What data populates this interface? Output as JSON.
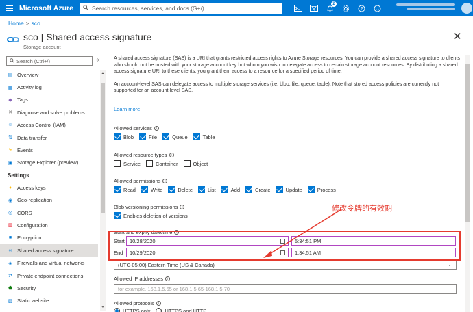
{
  "topbar": {
    "brand": "Microsoft Azure",
    "search_placeholder": "Search resources, services, and docs (G+/)",
    "notification_count": "2",
    "icons": [
      "cloud-shell-icon",
      "directory-filter-icon",
      "bell-icon",
      "gear-icon",
      "help-icon",
      "feedback-icon"
    ]
  },
  "breadcrumb": {
    "home": "Home",
    "separator": ">",
    "resource": "sco"
  },
  "header": {
    "title": "sco | Shared access signature",
    "subtitle": "Storage account",
    "close": "✕"
  },
  "sidebar": {
    "search_placeholder": "Search (Ctrl+/)",
    "collapse_icon": "«",
    "items": [
      {
        "label": "Overview",
        "icon": "overview-icon",
        "color": "#0078d4"
      },
      {
        "label": "Activity log",
        "icon": "activity-log-icon",
        "color": "#0078d4"
      },
      {
        "label": "Tags",
        "icon": "tag-icon",
        "color": "#8764b8"
      },
      {
        "label": "Diagnose and solve problems",
        "icon": "wrench-icon",
        "color": "#605e5c"
      },
      {
        "label": "Access Control (IAM)",
        "icon": "people-icon",
        "color": "#0078d4"
      },
      {
        "label": "Data transfer",
        "icon": "data-transfer-icon",
        "color": "#0078d4"
      },
      {
        "label": "Events",
        "icon": "lightning-icon",
        "color": "#ffb900"
      },
      {
        "label": "Storage Explorer (preview)",
        "icon": "storage-explorer-icon",
        "color": "#0078d4"
      }
    ],
    "section_settings": "Settings",
    "settings_items": [
      {
        "label": "Access keys",
        "icon": "key-icon",
        "color": "#ffb900"
      },
      {
        "label": "Geo-replication",
        "icon": "globe-icon",
        "color": "#0078d4"
      },
      {
        "label": "CORS",
        "icon": "cors-icon",
        "color": "#0078d4"
      },
      {
        "label": "Configuration",
        "icon": "configuration-icon",
        "color": "#e81123"
      },
      {
        "label": "Encryption",
        "icon": "lock-icon",
        "color": "#0078d4"
      },
      {
        "label": "Shared access signature",
        "icon": "link-icon",
        "color": "#0078d4",
        "selected": true
      },
      {
        "label": "Firewalls and virtual networks",
        "icon": "firewall-icon",
        "color": "#0078d4"
      },
      {
        "label": "Private endpoint connections",
        "icon": "private-endpoint-icon",
        "color": "#0078d4"
      },
      {
        "label": "Security",
        "icon": "shield-icon",
        "color": "#107c10"
      },
      {
        "label": "Static website",
        "icon": "static-website-icon",
        "color": "#0078d4"
      }
    ]
  },
  "main": {
    "description1": "A shared access signature (SAS) is a URI that grants restricted access rights to Azure Storage resources. You can provide a shared access signature to clients who should not be trusted with your storage account key but whom you wish to delegate access to certain storage account resources. By distributing a shared access signature URI to these clients, you grant them access to a resource for a specified period of time.",
    "description2": "An account-level SAS can delegate access to multiple storage services (i.e. blob, file, queue, table). Note that stored access policies are currently not supported for an account-level SAS.",
    "learn_more": "Learn more",
    "allowed_services_label": "Allowed services",
    "services": [
      {
        "label": "Blob",
        "checked": true
      },
      {
        "label": "File",
        "checked": true
      },
      {
        "label": "Queue",
        "checked": true
      },
      {
        "label": "Table",
        "checked": true
      }
    ],
    "allowed_resource_types_label": "Allowed resource types",
    "resource_types": [
      {
        "label": "Service",
        "checked": false
      },
      {
        "label": "Container",
        "checked": false
      },
      {
        "label": "Object",
        "checked": false
      }
    ],
    "allowed_permissions_label": "Allowed permissions",
    "permissions": [
      {
        "label": "Read",
        "checked": true
      },
      {
        "label": "Write",
        "checked": true
      },
      {
        "label": "Delete",
        "checked": true
      },
      {
        "label": "List",
        "checked": true
      },
      {
        "label": "Add",
        "checked": true
      },
      {
        "label": "Create",
        "checked": true
      },
      {
        "label": "Update",
        "checked": true
      },
      {
        "label": "Process",
        "checked": true
      }
    ],
    "blob_versioning_label": "Blob versioning permissions",
    "blob_versioning_option": "Enables deletion of versions",
    "blob_versioning_checked": true,
    "start_expiry_label": "Start and expiry date/time",
    "start_label": "Start",
    "start_date": "10/28/2020",
    "start_time": "5:34:51 PM",
    "end_label": "End",
    "end_date": "10/29/2020",
    "end_time": "1:34:51 AM",
    "timezone": "(UTC-05:00) Eastern Time (US & Canada)",
    "allowed_ip_label": "Allowed IP addresses",
    "ip_placeholder": "for example, 168.1.5.65 or 168.1.5.65-168.1.5.70",
    "allowed_protocols_label": "Allowed protocols",
    "protocols": [
      {
        "label": "HTTPS only",
        "selected": true
      },
      {
        "label": "HTTPS and HTTP",
        "selected": false
      }
    ]
  },
  "annotation": {
    "text": "修改令牌的有效期",
    "color": "#e53b2f"
  },
  "colors": {
    "azure_blue": "#0078d4",
    "highlight_red": "#e53b2f",
    "field_border": "#b146c2"
  }
}
